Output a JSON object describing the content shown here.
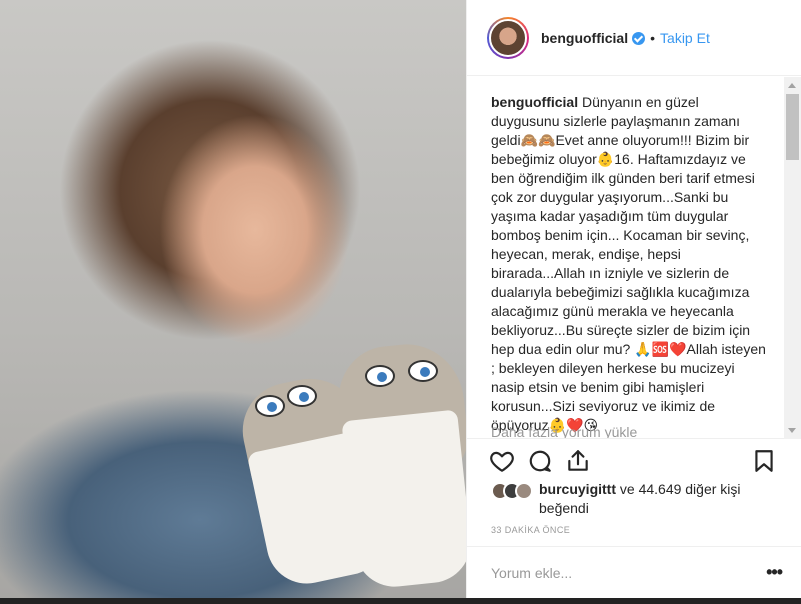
{
  "post": {
    "username": "benguofficial",
    "dot": "•",
    "follow_label": "Takip Et"
  },
  "caption": {
    "username": "benguofficial",
    "text": "Dünyanın en güzel duygusunu sizlerle paylaşmanın zamanı geldi🙈🙈Evet anne oluyorum!!! Bizim bir bebeğimiz oluyor👶16. Haftamızdayız ve ben öğrendiğim ilk günden beri tarif etmesi çok zor duygular yaşıyorum...Sanki bu yaşıma kadar yaşadığım tüm duygular bomboş benim için... Kocaman bir sevinç, heyecan, merak, endişe, hepsi birarada...Allah ın izniyle ve sizlerin de dualarıyla bebeğimizi sağlıkla kucağımıza alacağımız günü merakla ve heyecanla bekliyoruz...Bu süreçte sizler de bizim için hep dua edin olur mu? 🙏🆘❤️Allah isteyen ; bekleyen dileyen herkese bu mucizeyi nasip etsin ve benim gibi hamişleri korusun...Sizi seviyoruz ve ikimiz de öpüyoruz👶❤️😘"
  },
  "load_more": "Daha fazla yorum yükle",
  "likes": {
    "user": "burcuyigittt",
    "rest": " ve 44.649 diğer kişi beğendi"
  },
  "time": "33 DAKİKA ÖNCE",
  "comment": {
    "placeholder": "Yorum ekle...",
    "more": "•••"
  },
  "icons": {
    "like": "heart-icon",
    "comment": "comment-icon",
    "share": "share-icon",
    "save": "bookmark-icon"
  },
  "colors": {
    "link": "#3897f0",
    "text": "#262626",
    "muted": "#999999",
    "border": "#efefef"
  }
}
